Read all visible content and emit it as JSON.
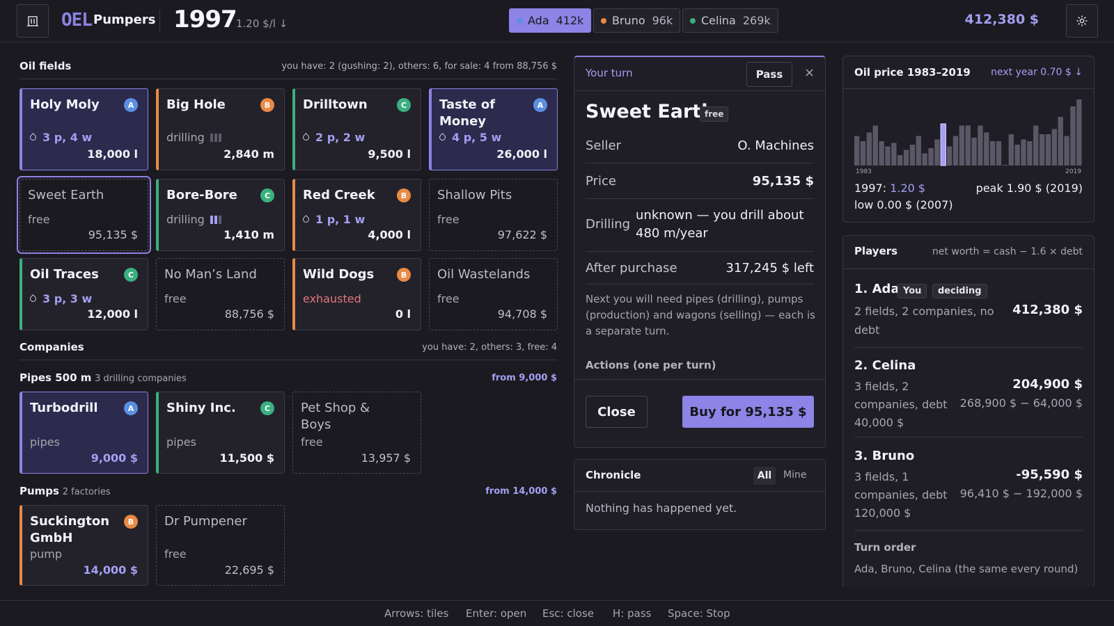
{
  "app": {
    "logo": "OEL",
    "name": "Pumpers",
    "year": "1997",
    "price": "1.20 $/l ↓",
    "money": "412,380 $"
  },
  "players_bar": [
    {
      "name": "Ada",
      "value": "412k",
      "color": "#5b8fe0",
      "active": true
    },
    {
      "name": "Bruno",
      "value": "96k",
      "color": "#e98a45",
      "active": false
    },
    {
      "name": "Celina",
      "value": "269k",
      "color": "#3bb07f",
      "active": false
    }
  ],
  "oilfields": {
    "title": "Oil fields",
    "info": "you have: 2 (gushing: 2), others: 6, for sale: 4 from 88,756 $",
    "tiles": [
      {
        "name": "Holy Moly",
        "owner": "A",
        "sub": "3 p, 4 w",
        "value": "18,000 l"
      },
      {
        "name": "Big Hole",
        "owner": "B",
        "sub": "drilling",
        "value": "2,840 m"
      },
      {
        "name": "Drilltown",
        "owner": "C",
        "sub": "2 p, 2 w",
        "value": "9,500 l"
      },
      {
        "name": "Taste of Money",
        "owner": "A",
        "sub": "4 p, 5 w",
        "value": "26,000 l"
      },
      {
        "name": "Sweet Earth",
        "owner": "",
        "sub": "free",
        "value": "95,135 $"
      },
      {
        "name": "Bore-Bore",
        "owner": "C",
        "sub": "drilling",
        "value": "1,410 m"
      },
      {
        "name": "Red Creek",
        "owner": "B",
        "sub": "1 p, 1 w",
        "value": "4,000 l"
      },
      {
        "name": "Shallow Pits",
        "owner": "",
        "sub": "free",
        "value": "97,622 $"
      },
      {
        "name": "Oil Traces",
        "owner": "C",
        "sub": "3 p, 3 w",
        "value": "12,000 l"
      },
      {
        "name": "No Man’s Land",
        "owner": "",
        "sub": "free",
        "value": "88,756 $"
      },
      {
        "name": "Wild Dogs",
        "owner": "B",
        "sub": "exhausted",
        "value": "0 l"
      },
      {
        "name": "Oil Wastelands",
        "owner": "",
        "sub": "free",
        "value": "94,708 $"
      }
    ]
  },
  "companies": {
    "title": "Companies",
    "info": "you have: 2, others: 3, free: 4",
    "pipes": {
      "title": "Pipes 500 m",
      "sub": "3 drilling companies",
      "from": "from 9,000 $"
    },
    "pumps": {
      "title": "Pumps",
      "sub": "2 factories",
      "from": "from 14,000 $"
    },
    "pipe_tiles": [
      {
        "name": "Turbodrill",
        "owner": "A",
        "sub": "pipes",
        "value": "9,000 $"
      },
      {
        "name": "Shiny Inc.",
        "owner": "C",
        "sub": "pipes",
        "value": "11,500 $"
      },
      {
        "name": "Pet Shop & Boys",
        "owner": "",
        "sub": "free",
        "value": "13,957 $"
      }
    ],
    "pump_tiles": [
      {
        "name": "Suckington GmbH",
        "owner": "B",
        "sub": "pump",
        "value": "14,000 $"
      },
      {
        "name": "Dr Pumpener",
        "owner": "",
        "sub": "free",
        "value": "22,695 $"
      }
    ]
  },
  "turn": {
    "label": "Your turn",
    "pass": "Pass",
    "close_x": "×",
    "field": "Sweet Earth",
    "tag": "free",
    "seller_label": "Seller",
    "seller": "O. Machines",
    "price_label": "Price",
    "price": "95,135 $",
    "drilling_label": "Drilling",
    "drilling": "unknown — you drill about 480 m/year",
    "after_label": "After purchase",
    "after": "317,245 $ left",
    "note": "Next you will need pipes (drilling), pumps (production) and wagons (selling) — each is a separate turn.",
    "actions": "Actions (one per turn)",
    "close_btn": "Close",
    "buy_btn": "Buy for 95,135 $"
  },
  "chronicle": {
    "title": "Chronicle",
    "tab_all": "All",
    "tab_mine": "Mine",
    "empty": "Nothing has happened yet."
  },
  "oilprice": {
    "title": "Oil price 1983–2019",
    "next": "next year 0.70 $ ↓",
    "start": "1983",
    "end": "2019",
    "current_label": "1997:",
    "current": "1.20 $",
    "peak": "peak 1.90 $ (2019)",
    "low": "low 0.00 $ (2007)"
  },
  "chart_data": {
    "type": "bar",
    "x": [
      1983,
      1984,
      1985,
      1986,
      1987,
      1988,
      1989,
      1990,
      1991,
      1992,
      1993,
      1994,
      1995,
      1996,
      1997,
      1998,
      1999,
      2000,
      2001,
      2002,
      2003,
      2004,
      2005,
      2006,
      2007,
      2008,
      2009,
      2010,
      2011,
      2012,
      2013,
      2014,
      2015,
      2016,
      2017,
      2018,
      2019
    ],
    "values": [
      0.85,
      0.7,
      0.95,
      1.15,
      0.7,
      0.55,
      0.65,
      0.3,
      0.45,
      0.6,
      0.85,
      0.35,
      0.5,
      0.75,
      1.2,
      0.55,
      0.85,
      1.15,
      1.15,
      0.8,
      1.15,
      0.95,
      0.7,
      0.7,
      0.0,
      0.9,
      0.6,
      0.75,
      0.7,
      1.15,
      0.9,
      0.9,
      1.05,
      1.4,
      0.85,
      1.7,
      1.9
    ],
    "highlight": 1997
  },
  "players": {
    "title": "Players",
    "formula": "net worth = cash − 1.6 × debt",
    "list": [
      {
        "rank": "1. Ada",
        "tags": [
          "You",
          "deciding"
        ],
        "desc": "2 fields, 2 companies, no debt",
        "worth": "412,380 $",
        "calc": ""
      },
      {
        "rank": "2. Celina",
        "tags": [],
        "desc": "3 fields, 2 companies, debt 40,000 $",
        "worth": "204,900 $",
        "calc": "268,900 $ − 64,000 $"
      },
      {
        "rank": "3. Bruno",
        "tags": [],
        "desc": "3 fields, 1 companies, debt 120,000 $",
        "worth": "-95,590 $",
        "calc": "96,410 $ − 192,000 $"
      }
    ],
    "turn_order_label": "Turn order",
    "turn_order": "Ada, Bruno, Celina (the same every round)"
  },
  "footer": [
    "Arrows: tiles",
    "Enter: open",
    "Esc: close",
    "H: pass",
    "Space: Stop"
  ]
}
